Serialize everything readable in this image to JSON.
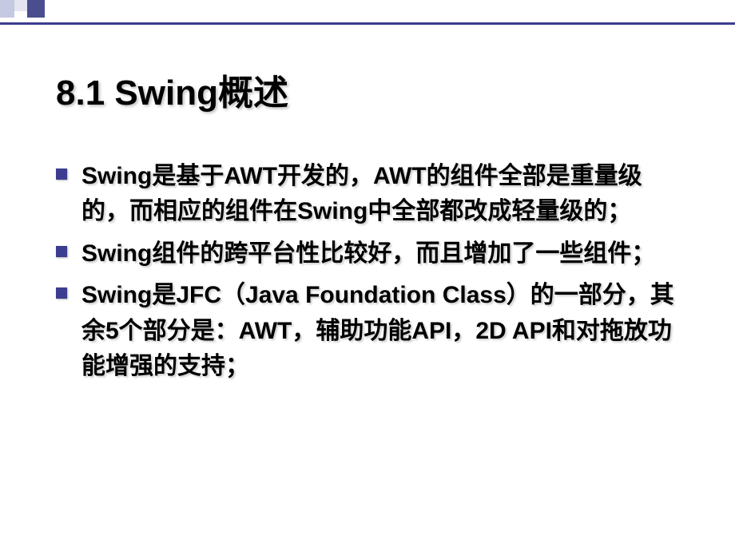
{
  "slide": {
    "title": "8.1 Swing概述",
    "bullets": [
      "Swing是基于AWT开发的，AWT的组件全部是重量级的，而相应的组件在Swing中全部都改成轻量级的；",
      "Swing组件的跨平台性比较好，而且增加了一些组件；",
      "Swing是JFC（Java Foundation Class）的一部分，其余5个部分是：AWT，辅助功能API，2D API和对拖放功能增强的支持；"
    ]
  }
}
